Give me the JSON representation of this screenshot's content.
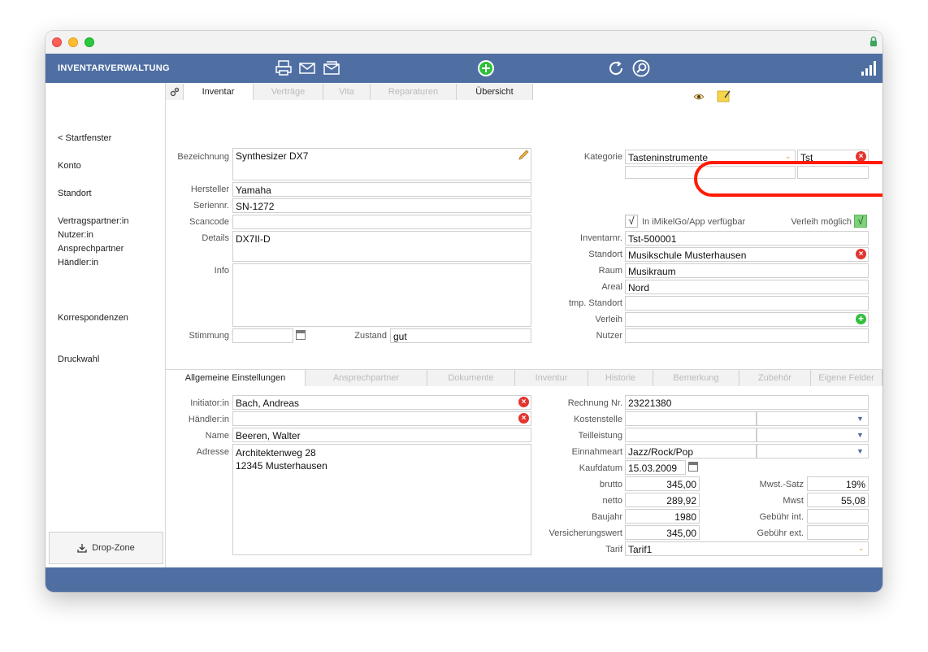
{
  "app": {
    "title": "INVENTARVERWALTUNG"
  },
  "sidebar": {
    "items": [
      "< Startfenster",
      "Konto",
      "Standort",
      "Vertragspartner:in",
      "Nutzer:in",
      "Ansprechpartner",
      "Händler:in",
      "Korrespondenzen",
      "Druckwahl"
    ],
    "dropzone": "Drop-Zone"
  },
  "top_tabs": [
    "Inventar",
    "Verträge",
    "Vita",
    "Reparaturen",
    "Übersicht"
  ],
  "bottom_tabs": [
    "Allgemeine Einstellungen",
    "Ansprechpartner",
    "Dokumente",
    "Inventur",
    "Historie",
    "Bemerkung",
    "Zubehör",
    "Eigene Felder"
  ],
  "left": {
    "bezeichnung_label": "Bezeichnung",
    "bezeichnung": "Synthesizer DX7",
    "hersteller_label": "Hersteller",
    "hersteller": "Yamaha",
    "seriennr_label": "Seriennr.",
    "seriennr": "SN-1272",
    "scancode_label": "Scancode",
    "scancode": "",
    "details_label": "Details",
    "details": "DX7II-D",
    "info_label": "Info",
    "info": "",
    "stimmung_label": "Stimmung",
    "stimmung": "",
    "zustand_label": "Zustand",
    "zustand": "gut"
  },
  "right": {
    "kategorie_label": "Kategorie",
    "kategorie": "Tasteninstrumente",
    "kategorie_code": "Tst",
    "app_label": "In iMikelGo/App verfügbar",
    "app_check": "√",
    "verleih_moeglich_label": "Verleih möglich",
    "verleih_check": "√",
    "inventarnr_label": "Inventarnr.",
    "inventarnr": "Tst-500001",
    "standort_label": "Standort",
    "standort": "Musikschule Musterhausen",
    "raum_label": "Raum",
    "raum": "Musikraum",
    "areal_label": "Areal",
    "areal": "Nord",
    "tmp_standort_label": "tmp. Standort",
    "tmp_standort": "",
    "verleih_label": "Verleih",
    "verleih": "",
    "nutzer_label": "Nutzer",
    "nutzer": ""
  },
  "general": {
    "initiator_label": "Initiator:in",
    "initiator": "Bach, Andreas",
    "haendler_label": "Händler:in",
    "haendler": "",
    "name_label": "Name",
    "name": "Beeren, Walter",
    "adresse_label": "Adresse",
    "adresse": "Architektenweg 28\n12345 Musterhausen",
    "rechnung_label": "Rechnung Nr.",
    "rechnung": "23221380",
    "kostenstelle_label": "Kostenstelle",
    "kostenstelle": "",
    "teilleistung_label": "Teilleistung",
    "teilleistung": "",
    "einnahmeart_label": "Einnahmeart",
    "einnahmeart": "Jazz/Rock/Pop",
    "kaufdatum_label": "Kaufdatum",
    "kaufdatum": "15.03.2009",
    "brutto_label": "brutto",
    "brutto": "345,00",
    "netto_label": "netto",
    "netto": "289,92",
    "baujahr_label": "Baujahr",
    "baujahr": "1980",
    "versicherungswert_label": "Versicherungswert",
    "versicherungswert": "345,00",
    "tarif_label": "Tarif",
    "tarif": "Tarif1",
    "mwst_satz_label": "Mwst.-Satz",
    "mwst_satz": "19%",
    "mwst_label": "Mwst",
    "mwst": "55,08",
    "gebuehr_int_label": "Gebühr int.",
    "gebuehr_int": "",
    "gebuehr_ext_label": "Gebühr ext.",
    "gebuehr_ext": ""
  },
  "colors": {
    "appbar": "#4f6fa3",
    "highlight": "#ff1a00",
    "delete": "#e3342f",
    "add": "#2fbf3a"
  },
  "icons": [
    "print-icon",
    "mail-icon",
    "mail-open-icon",
    "add-icon",
    "refresh-icon",
    "search-icon",
    "stats-icon",
    "settings-icon",
    "eye-icon",
    "note-icon",
    "pencil-icon",
    "lock-icon",
    "download-icon"
  ]
}
